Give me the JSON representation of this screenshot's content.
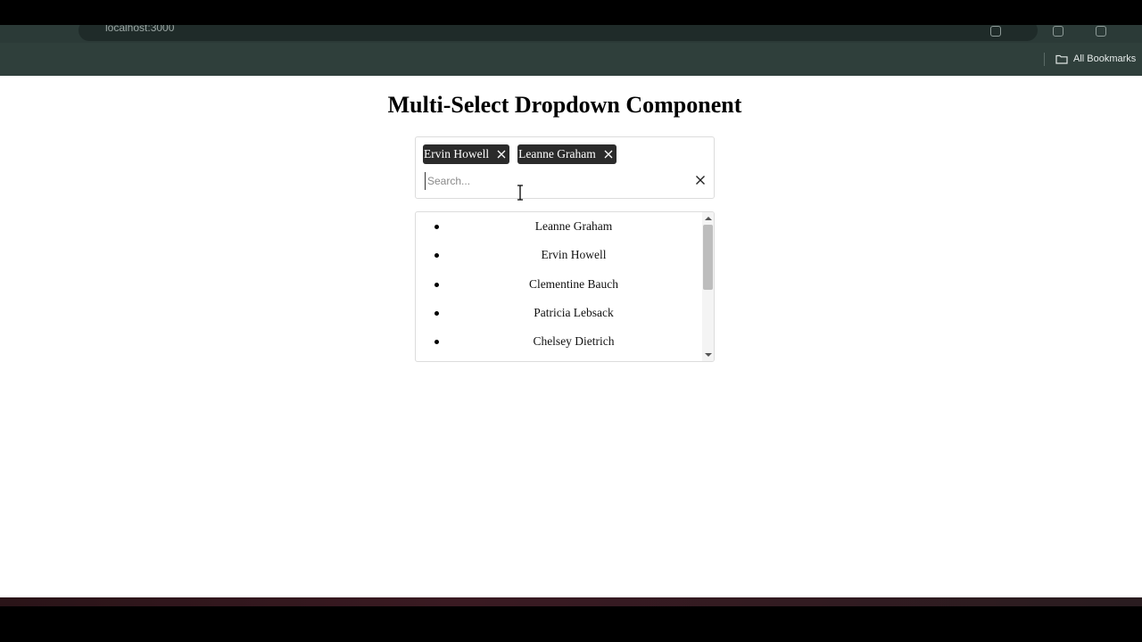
{
  "browser": {
    "url": "localhost:3000",
    "bookmarks_label": "All Bookmarks"
  },
  "page": {
    "title": "Multi-Select Dropdown Component"
  },
  "select": {
    "selected": [
      {
        "label": "Ervin Howell"
      },
      {
        "label": "Leanne Graham"
      }
    ],
    "search_placeholder": "Search...",
    "search_value": ""
  },
  "dropdown": {
    "options": [
      {
        "label": "Leanne Graham"
      },
      {
        "label": "Ervin Howell"
      },
      {
        "label": "Clementine Bauch"
      },
      {
        "label": "Patricia Lebsack"
      },
      {
        "label": "Chelsey Dietrich"
      }
    ]
  },
  "colors": {
    "chip_bg": "#2b2b2b",
    "toolbar_bg": "#2b3a37"
  }
}
